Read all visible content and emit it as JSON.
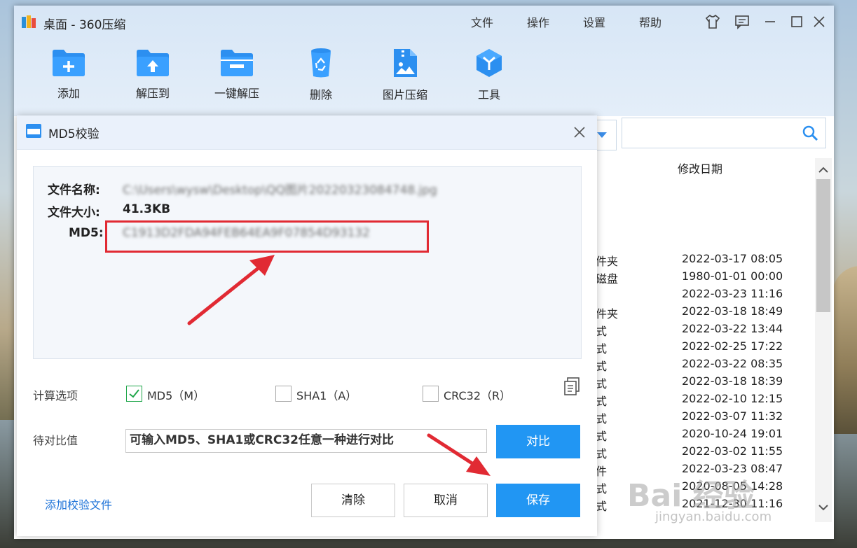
{
  "app": {
    "title": "桌面 - 360压缩",
    "menu": [
      "文件",
      "操作",
      "设置",
      "帮助"
    ],
    "toolbar": [
      "添加",
      "解压到",
      "一键解压",
      "删除",
      "图片压缩",
      "工具"
    ]
  },
  "file_list": {
    "date_header": "修改日期",
    "rows": [
      {
        "type": "件夹",
        "date": "2022-03-17 08:05"
      },
      {
        "type": "磁盘",
        "date": "1980-01-01 00:00"
      },
      {
        "type": "",
        "date": "2022-03-23 11:16"
      },
      {
        "type": "件夹",
        "date": "2022-03-18 18:49"
      },
      {
        "type": "式",
        "date": "2022-03-22 13:44"
      },
      {
        "type": "式",
        "date": "2022-02-25 17:22"
      },
      {
        "type": "式",
        "date": "2022-03-22 08:35"
      },
      {
        "type": "式",
        "date": "2022-03-18 18:39"
      },
      {
        "type": "式",
        "date": "2022-02-10 12:15"
      },
      {
        "type": "式",
        "date": "2022-03-07 11:32"
      },
      {
        "type": "式",
        "date": "2020-10-24 19:01"
      },
      {
        "type": "式",
        "date": "2022-03-02 11:55"
      },
      {
        "type": "件",
        "date": "2022-03-23 08:47"
      },
      {
        "type": "式",
        "date": "2020-08-05 14:28"
      },
      {
        "type": "式",
        "date": "2021-12-30 11:16"
      }
    ]
  },
  "dialog": {
    "title": "MD5校验",
    "name_label": "文件名称:",
    "name_value": "C:\\Users\\wysw\\Desktop\\QQ图片20220323084748.jpg",
    "size_label": "文件大小:",
    "size_value": "41.3KB",
    "md5_label": "MD5:",
    "md5_value": "C1913D2FDA94FEB64EA9F07854D93132",
    "options_label": "计算选项",
    "options": [
      {
        "label": "MD5（M）",
        "checked": true
      },
      {
        "label": "SHA1（A）",
        "checked": false
      },
      {
        "label": "CRC32（R）",
        "checked": false
      }
    ],
    "compare_label": "待对比值",
    "compare_placeholder": "可输入MD5、SHA1或CRC32任意一种进行对比",
    "compare_button": "对比",
    "add_link": "添加校验文件",
    "clear_button": "清除",
    "cancel_button": "取消",
    "save_button": "保存"
  },
  "watermark": {
    "main": "Bai 经验",
    "sub": "jingyan.baidu.com"
  },
  "colors": {
    "primary": "#2196f3",
    "highlight": "#e12a33",
    "check": "#1fa64a",
    "link": "#1e73d8"
  }
}
